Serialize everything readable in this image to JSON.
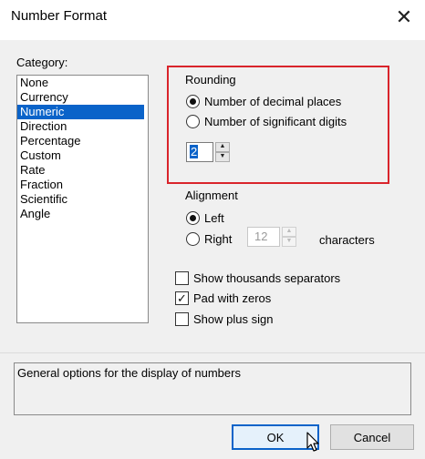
{
  "window": {
    "title": "Number Format",
    "close_glyph": "✕"
  },
  "category": {
    "label": "Category:",
    "items": [
      "None",
      "Currency",
      "Numeric",
      "Direction",
      "Percentage",
      "Custom",
      "Rate",
      "Fraction",
      "Scientific",
      "Angle"
    ],
    "selected": "Numeric"
  },
  "rounding": {
    "label": "Rounding",
    "option_decimal": "Number of decimal places",
    "option_significant": "Number of significant digits",
    "selected": "decimal",
    "value": "2"
  },
  "alignment": {
    "label": "Alignment",
    "option_left": "Left",
    "option_right": "Right",
    "selected": "left",
    "characters_value": "12",
    "characters_label": "characters"
  },
  "options": {
    "thousands": {
      "label": "Show thousands separators",
      "checked": false
    },
    "pad_zeros": {
      "label": "Pad with zeros",
      "checked": true
    },
    "plus_sign": {
      "label": "Show plus sign",
      "checked": false
    }
  },
  "description": "General options for the display of numbers",
  "buttons": {
    "ok": "OK",
    "cancel": "Cancel"
  },
  "colors": {
    "selection": "#0a63c9",
    "highlight_box": "#d9242b"
  },
  "icons": {
    "cursor": "arrow-cursor-icon",
    "check": "checkmark-icon"
  }
}
